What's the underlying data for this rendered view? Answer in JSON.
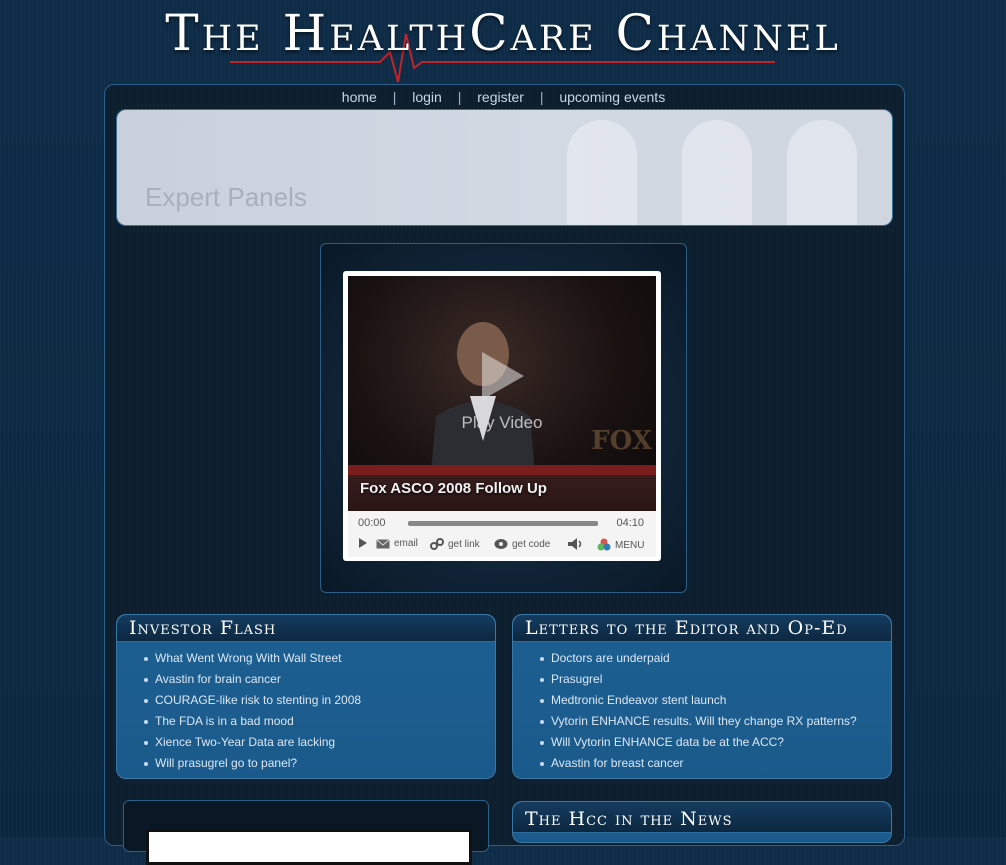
{
  "site": {
    "title": "The HealthCare Channel"
  },
  "nav": {
    "items": [
      {
        "label": "home"
      },
      {
        "label": "login"
      },
      {
        "label": "register"
      },
      {
        "label": "upcoming events"
      }
    ],
    "separator": "|"
  },
  "banner": {
    "title": "Expert Panels"
  },
  "player": {
    "play_label": "Play Video",
    "clip_title": "Fox ASCO 2008 Follow Up",
    "time_current": "00:00",
    "time_total": "04:10",
    "controls": {
      "email": "email",
      "get_link": "get link",
      "get_code": "get code",
      "menu": "MENU"
    },
    "progress": 0
  },
  "investor_flash": {
    "title": "Investor Flash",
    "items": [
      "What Went Wrong With Wall Street",
      "Avastin for brain cancer",
      "COURAGE-like risk to stenting in 2008",
      "The FDA is in a bad mood",
      "Xience Two-Year Data are lacking",
      "Will prasugrel go to panel?"
    ]
  },
  "letters": {
    "title": "Letters to the Editor and Op-Ed",
    "items": [
      "Doctors are underpaid",
      "Prasugrel",
      "Medtronic Endeavor stent launch",
      "Vytorin ENHANCE results. Will they change RX patterns?",
      "Will Vytorin ENHANCE data be at the ACC?",
      "Avastin for breast cancer"
    ]
  },
  "news": {
    "title": "The Hcc in the News"
  }
}
